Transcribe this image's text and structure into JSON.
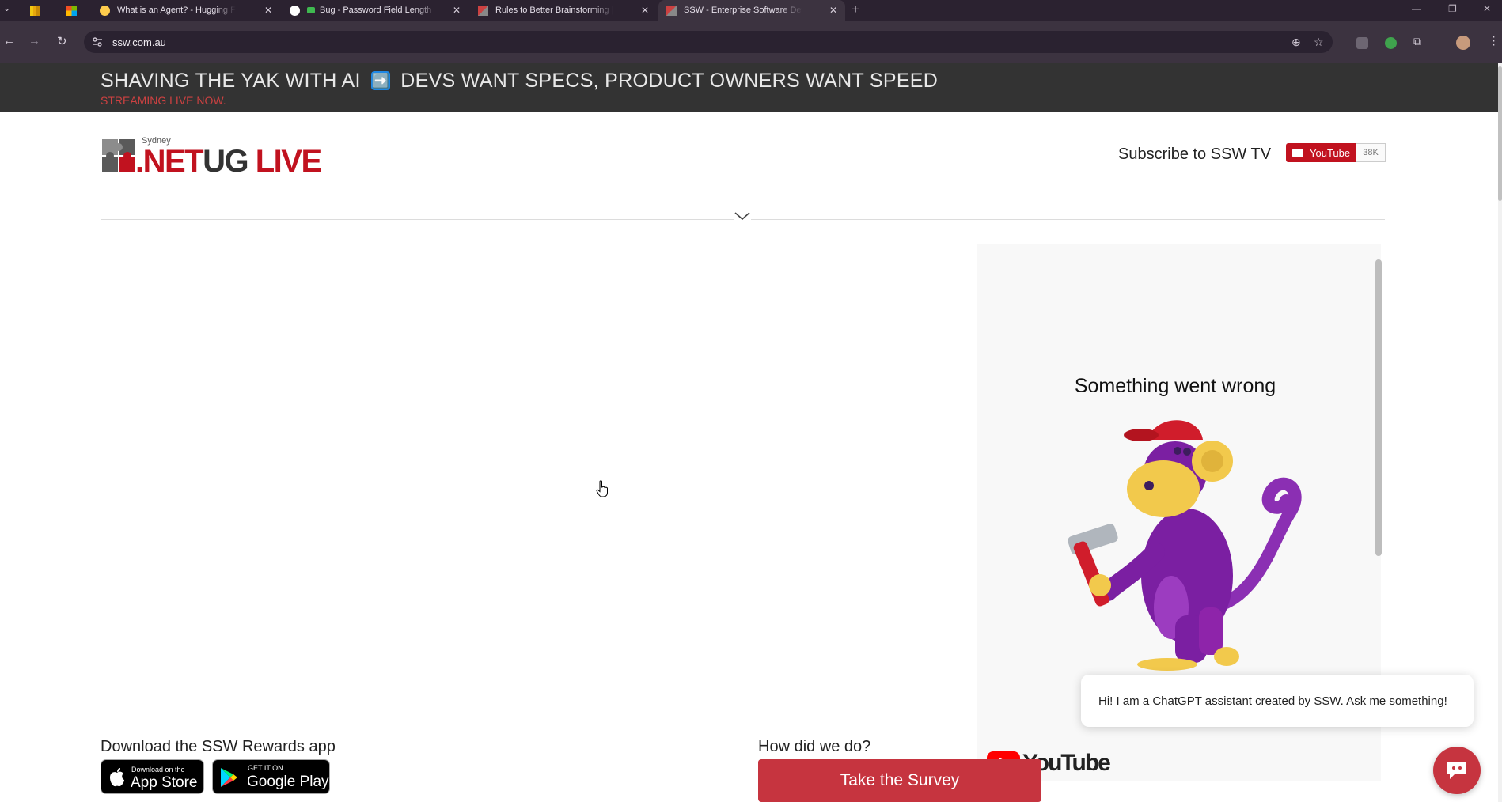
{
  "browser": {
    "tabs": [
      {
        "title": "",
        "icon": "power-bi-icon"
      },
      {
        "title": "",
        "icon": "microsoft-icon"
      },
      {
        "title": "What is an Agent? - Hugging Face",
        "icon": "hugging-face-icon"
      },
      {
        "title": "Bug - Password Field Length",
        "icon": "github-icon"
      },
      {
        "title": "Rules to Better Brainstorming | SSW",
        "icon": "ssw-icon"
      },
      {
        "title": "SSW - Enterprise Software Development",
        "icon": "ssw-icon",
        "active": true
      }
    ],
    "url": "ssw.com.au"
  },
  "banner": {
    "headline_left": "SHAVING THE YAK WITH AI",
    "headline_arrow": "➡️",
    "headline_right": "DEVS WANT SPECS, PRODUCT OWNERS WANT SPEED",
    "subtitle": "STREAMING LIVE NOW."
  },
  "header": {
    "logo": {
      "small": "Sydney",
      "net": ".NET",
      "ug": "UG",
      "live": "LIVE"
    },
    "subscribe_label": "Subscribe to SSW TV",
    "youtube_button": "YouTube",
    "subscriber_count": "38K"
  },
  "video": {
    "error_text": "Something went wrong",
    "brand": "YouTube"
  },
  "chat": {
    "greeting": "Hi! I am a ChatGPT assistant created by SSW. Ask me something!"
  },
  "rewards": {
    "title": "Download the SSW Rewards app",
    "appstore_small": "Download on the",
    "appstore_big": "App Store",
    "googleplay_small": "GET IT ON",
    "googleplay_big": "Google Play"
  },
  "survey": {
    "title": "How did we do?",
    "button": "Take the Survey"
  },
  "colors": {
    "brand_red": "#c6343f",
    "banner_bg": "#333333",
    "banner_sub": "#cc4141",
    "youtube_red": "#ff0000"
  }
}
